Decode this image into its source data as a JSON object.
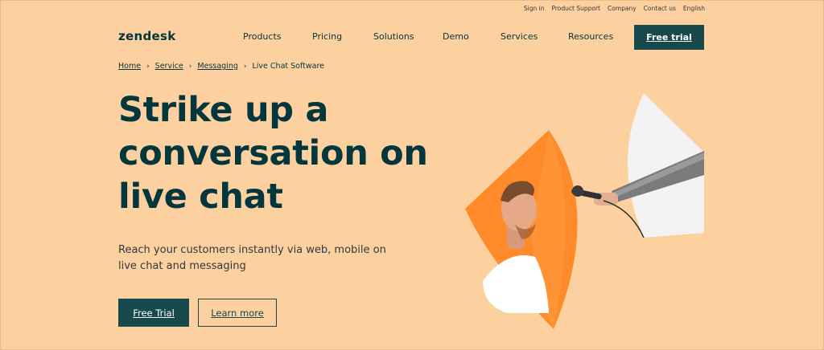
{
  "utility_nav": [
    "Sign in",
    "Product Support",
    "Company",
    "Contact us",
    "English"
  ],
  "logo": "zendesk",
  "nav": {
    "items": [
      "Products",
      "Pricing",
      "Solutions",
      "Demo",
      "Services",
      "Resources"
    ],
    "cta": "Free trial"
  },
  "breadcrumb": {
    "links": [
      "Home",
      "Service",
      "Messaging"
    ],
    "current": "Live Chat Software"
  },
  "hero": {
    "title_lines": [
      "Strike up a",
      "conversation on",
      "live chat"
    ],
    "subtitle": "Reach your customers instantly via web, mobile on live chat and messaging",
    "primary_button": "Free Trial",
    "secondary_button": "Learn more"
  },
  "colors": {
    "background": "#fdd19f",
    "brand_dark": "#17494d",
    "accent_orange": "#ff8a2a",
    "panel_white": "#f3f3f3"
  }
}
